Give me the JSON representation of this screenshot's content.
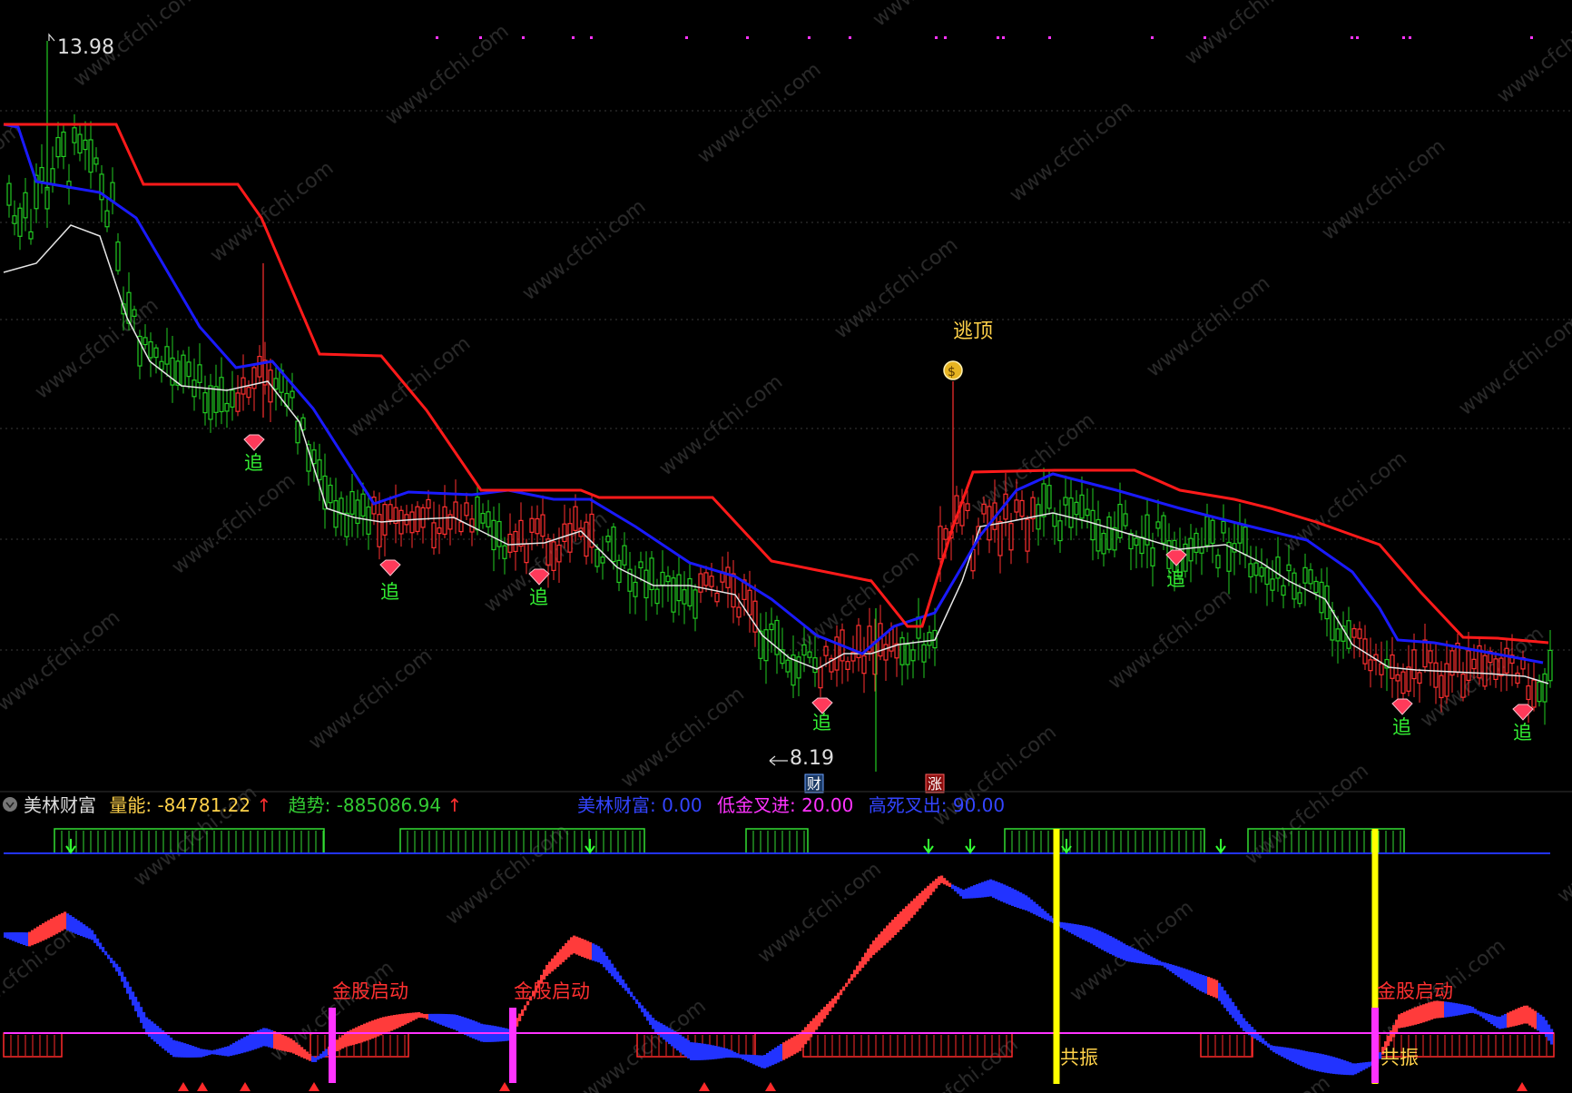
{
  "colors": {
    "background": "#000000",
    "up_candle": "#ff3030",
    "down_candle": "#22cc22",
    "upper_line": "#ff1a1a",
    "mid_line": "#1a1aff",
    "ma_line": "#e6e6e6",
    "yellow": "#ffff00",
    "magenta": "#ff33ff",
    "wave_red": "#ff3b3b",
    "wave_blue": "#2233ff",
    "green_box": "#33dd33",
    "red_box": "#ff2a2a",
    "label_gold": "#ffd24a",
    "label_green": "#33ee33"
  },
  "upper_chart": {
    "high_label": "13.98",
    "low_label": "8.19",
    "escape_top_label": "逃顶",
    "chase_label": "追",
    "badge_cai": "财",
    "badge_zhang": "涨"
  },
  "indicator_header": {
    "name": "美林财富",
    "volume_label": "量能:",
    "volume_value": "-84781.22",
    "volume_arrow": "↑",
    "trend_label": "趋势:",
    "trend_value": "-885086.94",
    "trend_arrow": "↑",
    "mlcf_label": "美林财富:",
    "mlcf_value": "0.00",
    "low_gold_label": "低金叉进:",
    "low_gold_value": "20.00",
    "high_dead_label": "高死叉出:",
    "high_dead_value": "90.00"
  },
  "lower_chart": {
    "golden_start_label": "金股启动",
    "resonance_label": "共振"
  },
  "chart_data": [
    {
      "type": "candlestick",
      "description_series": [
        "price candles",
        "upper band (red)",
        "mid band (blue)",
        "moving average (white)"
      ],
      "high": 13.98,
      "low": 8.19,
      "signals": [
        "逃顶",
        "追",
        "追",
        "追",
        "追",
        "追",
        "追",
        "追"
      ]
    },
    {
      "type": "area",
      "name": "美林财富",
      "values": {
        "量能": -84781.22,
        "趋势": -885086.94,
        "美林财富": 0.0,
        "低金叉进": 20.0,
        "高死叉出": 90.0
      },
      "signals": [
        "金股启动",
        "金股启动",
        "金股启动",
        "共振",
        "共振"
      ]
    }
  ]
}
